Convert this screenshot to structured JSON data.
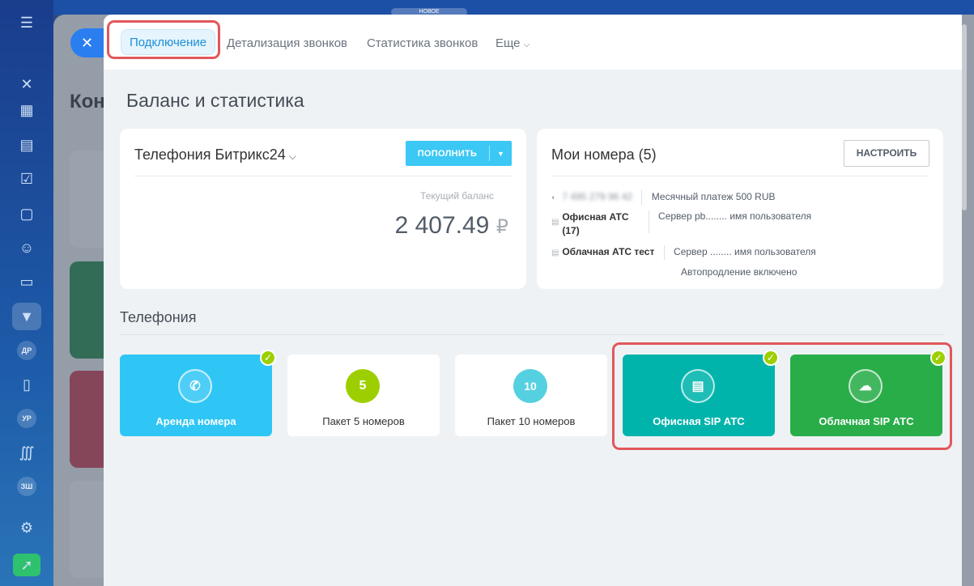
{
  "badge": "НОВОЕ",
  "under_page": {
    "title": "Кон"
  },
  "sidebar": {
    "items": [
      {
        "name": "menu-icon",
        "glyph": "☰"
      },
      {
        "name": "close-icon",
        "glyph": "✕"
      },
      {
        "name": "calendar-icon",
        "glyph": "▦"
      },
      {
        "name": "document-icon",
        "glyph": "▤"
      },
      {
        "name": "tasks-icon",
        "glyph": "☑"
      },
      {
        "name": "chat-icon",
        "glyph": "▢"
      },
      {
        "name": "contacts-icon",
        "glyph": "☺"
      },
      {
        "name": "card-icon",
        "glyph": "▭"
      },
      {
        "name": "funnel-icon",
        "glyph": "▼"
      },
      {
        "name": "avatar-dr",
        "text": "ДР"
      },
      {
        "name": "file-icon",
        "glyph": "▯"
      },
      {
        "name": "avatar-ur",
        "text": "УР"
      },
      {
        "name": "logo-icon",
        "glyph": "∭"
      },
      {
        "name": "avatar-zsh",
        "text": "ЗШ"
      },
      {
        "name": "gear-icon",
        "glyph": "⚙"
      },
      {
        "name": "rocket-icon",
        "glyph": "➚"
      }
    ]
  },
  "tabs": {
    "connection": "Подключение",
    "details": "Детализация звонков",
    "stats": "Статистика звонков",
    "more": "Еще"
  },
  "page_title": "Баланс и статистика",
  "balance_card": {
    "title": "Телефония Битрикс24",
    "topup_label": "ПОПОЛНИТЬ",
    "balance_label": "Текущий баланс",
    "balance_value": "2 407.49",
    "currency": "₽"
  },
  "numbers_card": {
    "title": "Мои номера (5)",
    "configure_label": "НАСТРОИТЬ",
    "rows": [
      {
        "name": "7 495 279 96 42",
        "info": "Месячный платеж 500 RUB"
      },
      {
        "name": "Офисная АТС (17)",
        "info": "Сервер pb........ имя пользователя"
      },
      {
        "name": "Облачная АТС тест",
        "info": "Сервер ........ имя пользователя"
      }
    ],
    "auto_renew": "Автопродление включено"
  },
  "telephony": {
    "section_title": "Телефония",
    "tiles": [
      {
        "label": "Аренда номера",
        "icon": "phone-rent-icon",
        "color": "#2fc6f6",
        "checked": true
      },
      {
        "label": "Пакет 5 номеров",
        "icon": "package-5-icon",
        "icon_text": "5",
        "color": "#ffffff",
        "checked": false
      },
      {
        "label": "Пакет 10 номеров",
        "icon": "package-10-icon",
        "icon_text": "10",
        "color": "#ffffff",
        "checked": false
      },
      {
        "label": "Офисная SIP АТС",
        "icon": "office-pbx-icon",
        "color": "#00b4ac",
        "checked": true
      },
      {
        "label": "Облачная SIP АТС",
        "icon": "cloud-pbx-icon",
        "color": "#29ad49",
        "checked": true
      }
    ]
  }
}
